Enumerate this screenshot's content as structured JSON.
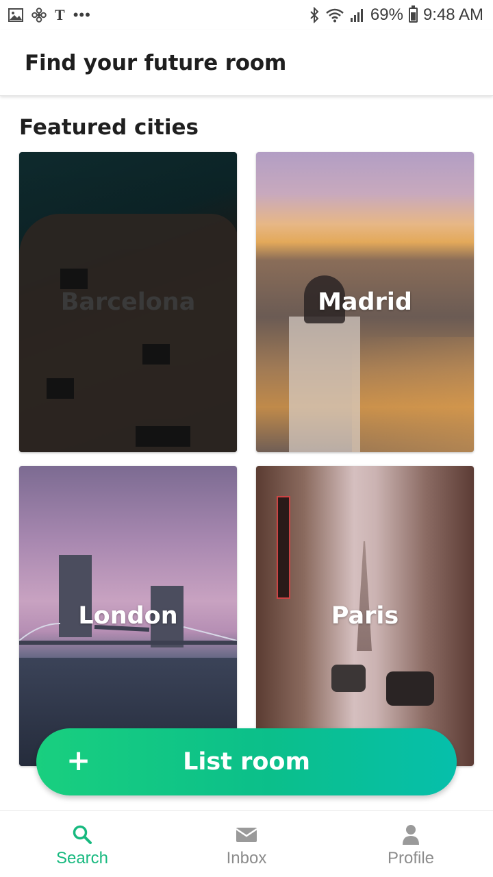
{
  "status_bar": {
    "left_icons": [
      "image-icon",
      "fan-icon",
      "t-icon",
      "more-dots-icon"
    ],
    "t_glyph": "T",
    "dots_glyph": "•••",
    "battery": "69%",
    "time": "9:48 AM"
  },
  "header": {
    "title": "Find your future room"
  },
  "featured": {
    "title": "Featured cities",
    "cities": [
      {
        "name": "Barcelona"
      },
      {
        "name": "Madrid"
      },
      {
        "name": "London"
      },
      {
        "name": "Paris"
      }
    ]
  },
  "list_room": {
    "plus": "+",
    "label": "List room"
  },
  "bottom_nav": {
    "items": [
      {
        "label": "Search",
        "icon": "search-icon",
        "active": true
      },
      {
        "label": "Inbox",
        "icon": "mail-icon",
        "active": false
      },
      {
        "label": "Profile",
        "icon": "person-icon",
        "active": false
      }
    ]
  },
  "colors": {
    "accent": "#17b97f",
    "button_start": "#19cf7f",
    "button_end": "#06bfab"
  },
  "battery_level": 0.69
}
